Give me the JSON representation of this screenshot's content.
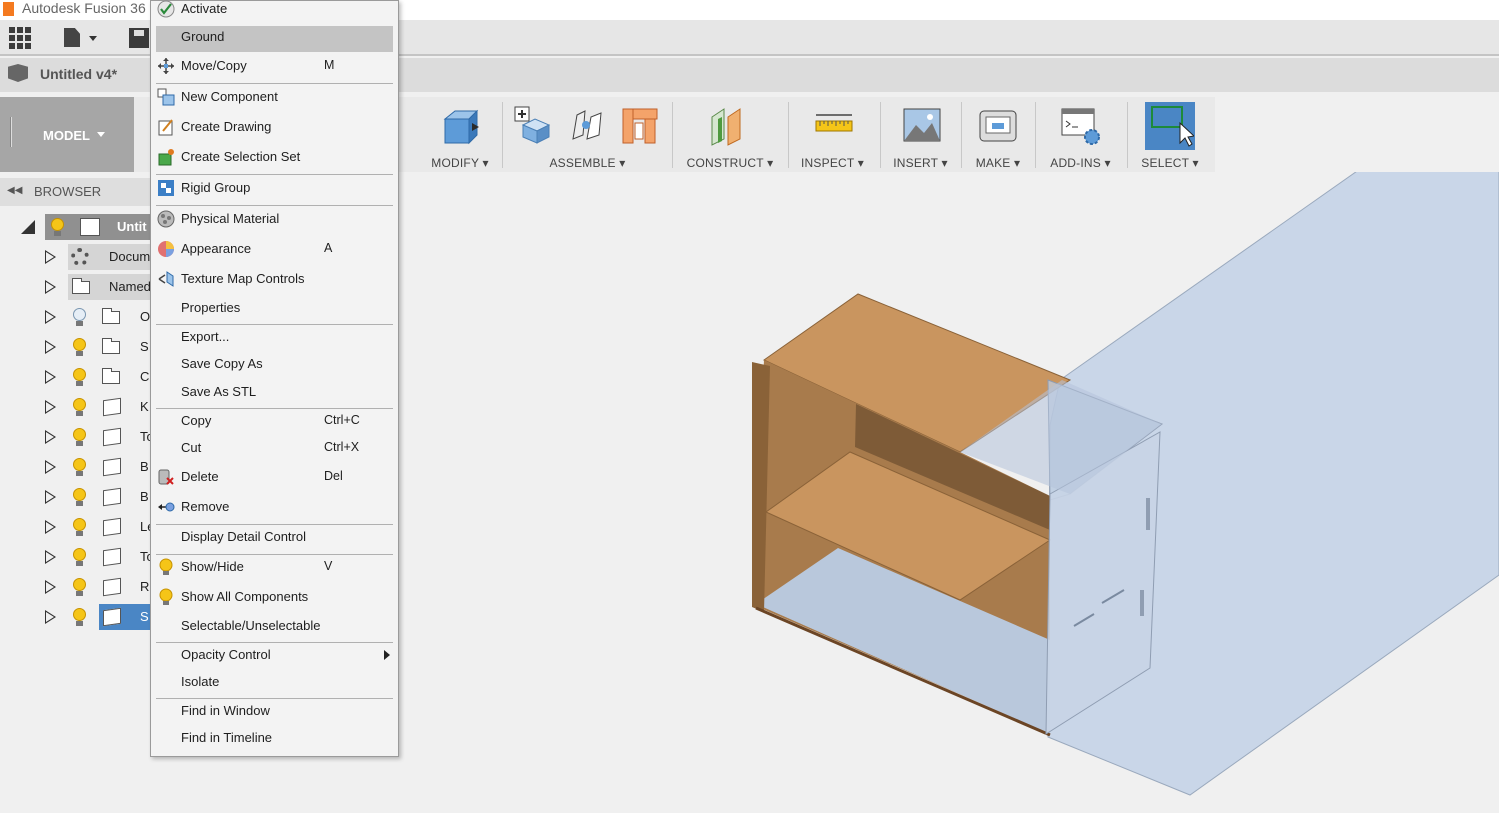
{
  "app": {
    "title": "Autodesk Fusion 36"
  },
  "document": {
    "title": "Untitled v4*"
  },
  "ribbon": {
    "workspace": "MODEL",
    "groups": [
      {
        "label": "MODIFY"
      },
      {
        "label": "ASSEMBLE"
      },
      {
        "label": "CONSTRUCT"
      },
      {
        "label": "INSPECT"
      },
      {
        "label": "INSERT"
      },
      {
        "label": "MAKE"
      },
      {
        "label": "ADD-INS"
      },
      {
        "label": "SELECT"
      }
    ]
  },
  "browser": {
    "header": "BROWSER",
    "rows": [
      {
        "text": "Untit"
      },
      {
        "text": "Docum"
      },
      {
        "text": "Named"
      },
      {
        "text": "O"
      },
      {
        "text": "S"
      },
      {
        "text": "C"
      },
      {
        "text": "K"
      },
      {
        "text": "To"
      },
      {
        "text": "B"
      },
      {
        "text": "B"
      },
      {
        "text": "Le"
      },
      {
        "text": "To"
      },
      {
        "text": "R"
      },
      {
        "text": "S"
      }
    ]
  },
  "context_menu": {
    "items": [
      {
        "label": "Activate",
        "shortcut": "",
        "icon": "check-circle-icon"
      },
      {
        "label": "Ground",
        "shortcut": "",
        "icon": ""
      },
      {
        "label": "Move/Copy",
        "shortcut": "M",
        "icon": "move-arrows-icon"
      },
      {
        "label": "New Component",
        "shortcut": "",
        "icon": "new-component-icon"
      },
      {
        "label": "Create Drawing",
        "shortcut": "",
        "icon": "create-drawing-icon"
      },
      {
        "label": "Create Selection Set",
        "shortcut": "",
        "icon": "selection-set-icon"
      },
      {
        "label": "Rigid Group",
        "shortcut": "",
        "icon": "rigid-group-icon"
      },
      {
        "label": "Physical Material",
        "shortcut": "",
        "icon": "physical-material-icon"
      },
      {
        "label": "Appearance",
        "shortcut": "A",
        "icon": "appearance-icon"
      },
      {
        "label": "Texture Map Controls",
        "shortcut": "",
        "icon": "texture-map-icon"
      },
      {
        "label": "Properties",
        "shortcut": "",
        "icon": ""
      },
      {
        "label": "Export...",
        "shortcut": "",
        "icon": ""
      },
      {
        "label": "Save Copy As",
        "shortcut": "",
        "icon": ""
      },
      {
        "label": "Save As STL",
        "shortcut": "",
        "icon": ""
      },
      {
        "label": "Copy",
        "shortcut": "Ctrl+C",
        "icon": ""
      },
      {
        "label": "Cut",
        "shortcut": "Ctrl+X",
        "icon": ""
      },
      {
        "label": "Delete",
        "shortcut": "Del",
        "icon": "delete-icon"
      },
      {
        "label": "Remove",
        "shortcut": "",
        "icon": "remove-icon"
      },
      {
        "label": "Display Detail Control",
        "shortcut": "",
        "icon": ""
      },
      {
        "label": "Show/Hide",
        "shortcut": "V",
        "icon": "lightbulb-icon"
      },
      {
        "label": "Show All Components",
        "shortcut": "",
        "icon": "lightbulb-icon"
      },
      {
        "label": "Selectable/Unselectable",
        "shortcut": "",
        "icon": ""
      },
      {
        "label": "Opacity Control",
        "shortcut": "",
        "icon": ""
      },
      {
        "label": "Isolate",
        "shortcut": "",
        "icon": ""
      },
      {
        "label": "Find in Window",
        "shortcut": "",
        "icon": ""
      },
      {
        "label": "Find in Timeline",
        "shortcut": "",
        "icon": ""
      }
    ]
  },
  "colors": {
    "accent_select": "#4a86c5",
    "menu_highlight": "#c4c4c4",
    "wood": "#c9955f",
    "plane": "#c9d6e8"
  }
}
